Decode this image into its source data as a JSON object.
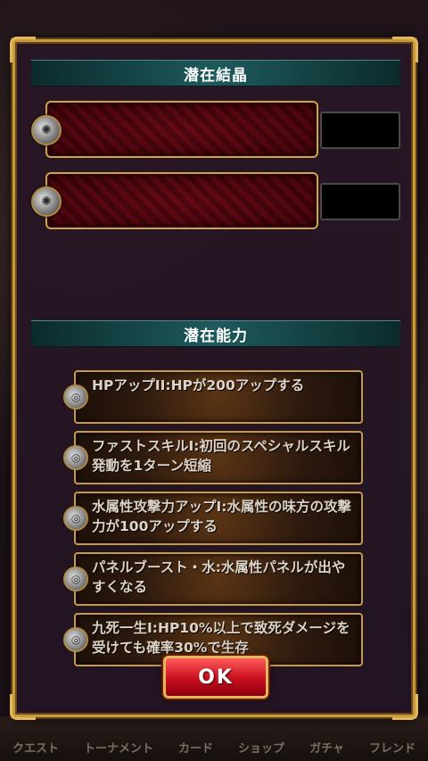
{
  "bottom_nav": [
    "クエスト",
    "トーナメント",
    "カード",
    "ショップ",
    "ガチャ",
    "フレンド"
  ],
  "crystals": {
    "header": "潜在結晶",
    "slots": [
      {
        "value": ""
      },
      {
        "value": ""
      }
    ]
  },
  "abilities": {
    "header": "潜在能力",
    "items": [
      {
        "icon": "ability-icon",
        "text": "HPアップII:HPが200アップする"
      },
      {
        "icon": "ability-icon",
        "text": "ファストスキルI:初回のスペシャルスキル発動を1ターン短縮"
      },
      {
        "icon": "ability-icon",
        "text": "水属性攻撃力アップI:水属性の味方の攻撃力が100アップする"
      },
      {
        "icon": "ability-icon",
        "text": "パネルブースト・水:水属性パネルが出やすくなる"
      },
      {
        "icon": "ability-icon",
        "text": "九死一生I:HP10%以上で致死ダメージを受けても確率30%で生存"
      }
    ]
  },
  "ok_label": "OK",
  "colors": {
    "frame": "#c99a3c",
    "header": "#1d5a5c",
    "ok": "#c80e1e"
  }
}
